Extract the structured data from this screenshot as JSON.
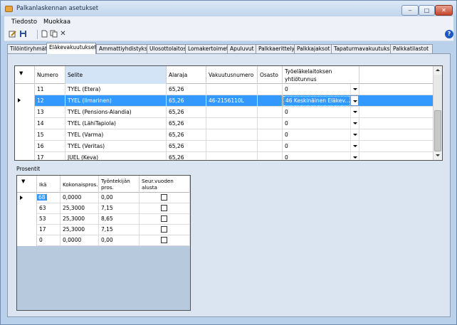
{
  "window": {
    "title": "Palkanlaskennan asetukset",
    "controls": {
      "minimize": "‒",
      "maximize": "□",
      "close": "✕"
    }
  },
  "menu": {
    "items": [
      "Tiedosto",
      "Muokkaa"
    ]
  },
  "toolbar": {
    "icons": [
      "edit-icon",
      "save-icon",
      "new-document-icon",
      "copy-icon",
      "delete-icon",
      "help-icon"
    ],
    "delete_glyph": "✕",
    "help_glyph": "?"
  },
  "tabs": [
    "Tilöintiryhmät",
    "Eläkevakuutukset",
    "Ammattiyhdistykset",
    "Ulosottolaitos",
    "Lomakertoimet",
    "Apuluvut",
    "Palkkaerittely",
    "Palkkajaksot",
    "Tapaturmavakuutukset",
    "Palkkatilastot"
  ],
  "active_tab": "Eläkevakuutukset",
  "insurance_grid": {
    "columns": [
      "Numero",
      "Selite",
      "Alaraja",
      "Vakuutusnumero",
      "Osasto",
      "Työeläkelaitoksen yhtiötunnus"
    ],
    "rows": [
      {
        "numero": "11",
        "selite": "TYEL (Etera)",
        "alaraja": "65,26",
        "vakuutusnumero": "",
        "osasto": "",
        "yhtiotunnus": "0"
      },
      {
        "numero": "12",
        "selite": "TYEL (Ilmarinen)",
        "alaraja": "65,26",
        "vakuutusnumero": "46-2156110L",
        "osasto": "",
        "yhtiotunnus": "46 Keskinäinen Eläkev..."
      },
      {
        "numero": "13",
        "selite": "TYEL (Pensions-Alandia)",
        "alaraja": "65,26",
        "vakuutusnumero": "",
        "osasto": "",
        "yhtiotunnus": "0"
      },
      {
        "numero": "14",
        "selite": "TYEL (LähiTapiola)",
        "alaraja": "65,26",
        "vakuutusnumero": "",
        "osasto": "",
        "yhtiotunnus": "0"
      },
      {
        "numero": "15",
        "selite": "TYEL (Varma)",
        "alaraja": "65,26",
        "vakuutusnumero": "",
        "osasto": "",
        "yhtiotunnus": "0"
      },
      {
        "numero": "16",
        "selite": "TYEL (Veritas)",
        "alaraja": "65,26",
        "vakuutusnumero": "",
        "osasto": "",
        "yhtiotunnus": "0"
      },
      {
        "numero": "17",
        "selite": "JUEL (Keva)",
        "alaraja": "65,26",
        "vakuutusnumero": "",
        "osasto": "",
        "yhtiotunnus": "0"
      }
    ]
  },
  "percent_section": {
    "label": "Prosentit",
    "columns": [
      "Ikä",
      "Kokonaispros.",
      "Työntekijän pros.",
      "Seur.vuoden alusta"
    ],
    "rows": [
      {
        "ika": "68",
        "kokonais": "0,0000",
        "tyontekija": "0,00",
        "seur": false
      },
      {
        "ika": "63",
        "kokonais": "25,3000",
        "tyontekija": "7,15",
        "seur": false
      },
      {
        "ika": "53",
        "kokonais": "25,3000",
        "tyontekija": "8,65",
        "seur": false
      },
      {
        "ika": "17",
        "kokonais": "25,3000",
        "tyontekija": "7,15",
        "seur": false
      },
      {
        "ika": "0",
        "kokonais": "0,0000",
        "tyontekija": "0,00",
        "seur": false
      }
    ]
  },
  "colors": {
    "selection": "#3399ff",
    "panel": "#dbe5f1",
    "window_frame": "#b9d1ea"
  }
}
